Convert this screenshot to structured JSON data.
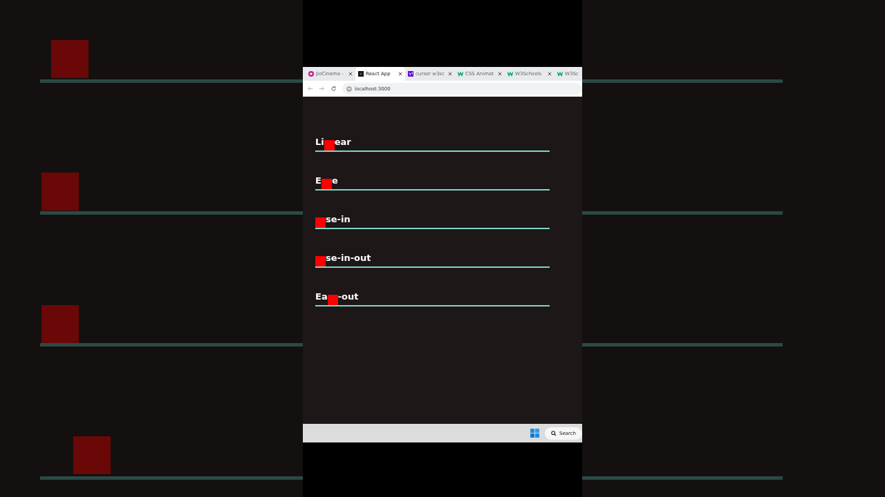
{
  "browser": {
    "tabs": [
      {
        "label": "JioCinema -",
        "kind": "circle",
        "selected": false
      },
      {
        "label": "React App",
        "kind": "square",
        "selected": true
      },
      {
        "label": "cursor w3sc",
        "kind": "yahoo",
        "selected": false
      },
      {
        "label": "CSS Animat",
        "kind": "zigzag",
        "selected": false
      },
      {
        "label": "W3Schools",
        "kind": "zigzag",
        "selected": false
      },
      {
        "label": "W3Sc",
        "kind": "zigzag",
        "selected": false
      }
    ],
    "address": "localhost:3000"
  },
  "rows": [
    {
      "before": "Li",
      "after": "ear"
    },
    {
      "before": "E",
      "after": "e"
    },
    {
      "after": "se-in"
    },
    {
      "after": "se-in-out"
    },
    {
      "before": "Ea",
      "after": "-out"
    }
  ],
  "taskbar": {
    "search": "Search"
  }
}
